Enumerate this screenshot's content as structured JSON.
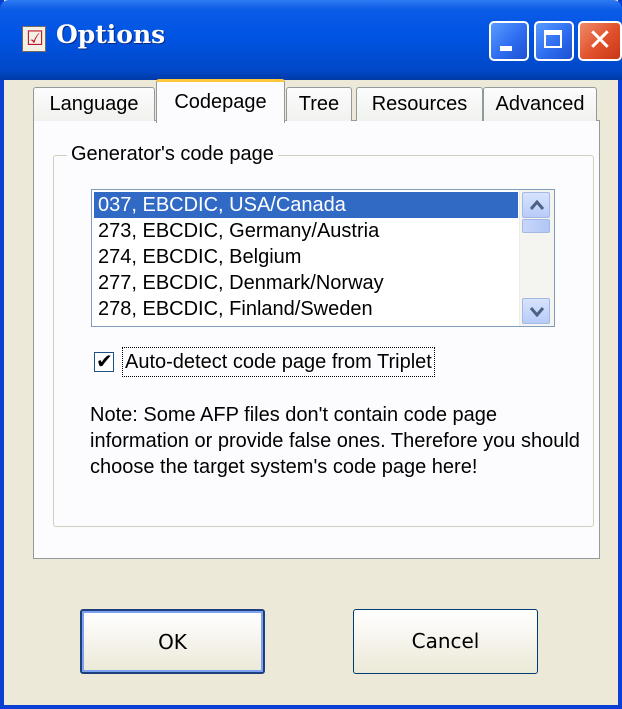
{
  "window": {
    "title": "Options",
    "controls": {
      "minimize": "minimize-icon",
      "maximize": "maximize-icon",
      "close": "close-icon"
    }
  },
  "tabs": [
    {
      "label": "Language",
      "selected": false
    },
    {
      "label": "Codepage",
      "selected": true
    },
    {
      "label": "Tree",
      "selected": false
    },
    {
      "label": "Resources",
      "selected": false
    },
    {
      "label": "Advanced",
      "selected": false
    }
  ],
  "codepage": {
    "group_label": "Generator's code page",
    "list_items": [
      "037, EBCDIC, USA/Canada",
      "273, EBCDIC, Germany/Austria",
      "274, EBCDIC, Belgium",
      "277, EBCDIC, Denmark/Norway",
      "278, EBCDIC, Finland/Sweden"
    ],
    "selected_item": "037, EBCDIC, USA/Canada",
    "autodetect_label": "Auto-detect code page from Triplet",
    "autodetect_checked": true,
    "note": "Note: Some AFP files don't contain code page information or provide false ones. Therefore you should choose the target system's code page here!"
  },
  "buttons": {
    "ok": "OK",
    "cancel": "Cancel"
  },
  "colors": {
    "titlebar": "#0054e3",
    "selection": "#316ac5",
    "face": "#ece9d8",
    "tab_highlight": "#ffc83c"
  }
}
